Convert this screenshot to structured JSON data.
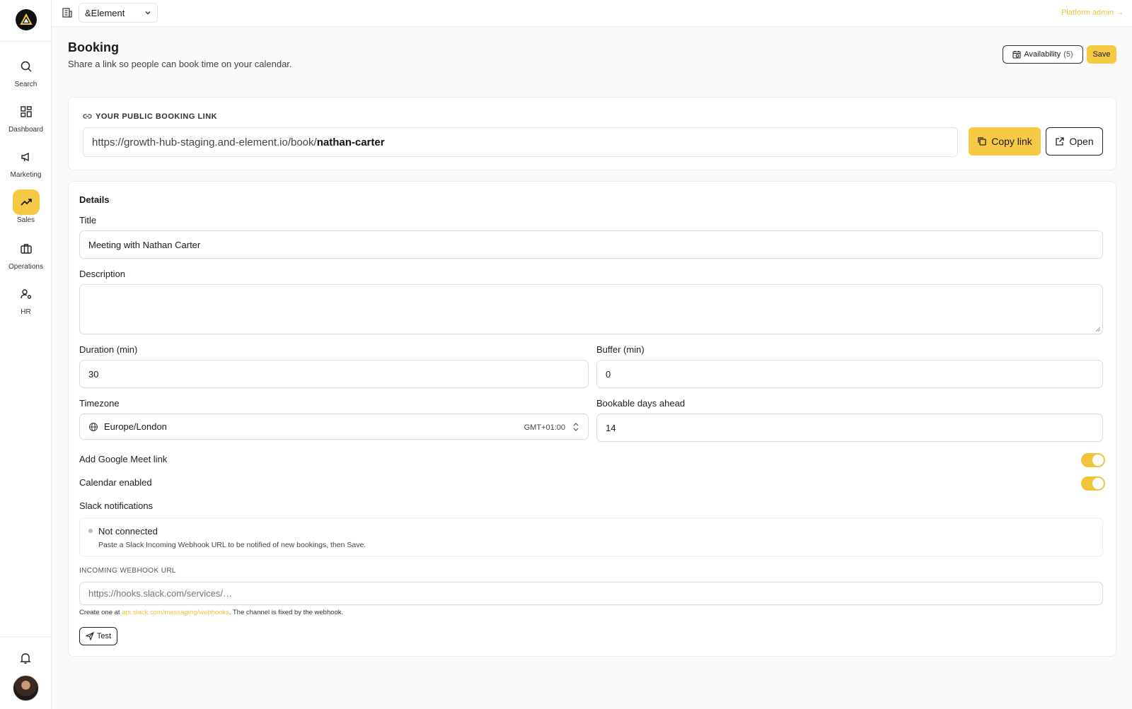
{
  "sidebar": {
    "items": [
      {
        "label": "Search",
        "icon": "search-icon"
      },
      {
        "label": "Dashboard",
        "icon": "dashboard-icon"
      },
      {
        "label": "Marketing",
        "icon": "megaphone-icon"
      },
      {
        "label": "Sales",
        "icon": "trending-up-icon",
        "active": true
      },
      {
        "label": "Operations",
        "icon": "briefcase-icon"
      },
      {
        "label": "HR",
        "icon": "user-cog-icon"
      }
    ]
  },
  "topbar": {
    "org": "&Element",
    "platform_admin": "Platform admin →"
  },
  "header": {
    "title": "Booking",
    "subtitle": "Share a link so people can book time on your calendar.",
    "availability_label": "Availability",
    "availability_count": "(5)",
    "save_label": "Save"
  },
  "link_card": {
    "heading": "YOUR PUBLIC BOOKING LINK",
    "url_prefix": "https://growth-hub-staging.and-element.io/book/",
    "url_slug": "nathan-carter",
    "copy_label": "Copy link",
    "open_label": "Open"
  },
  "details": {
    "section_title": "Details",
    "title_label": "Title",
    "title_value": "Meeting with Nathan Carter",
    "description_label": "Description",
    "description_value": "",
    "duration_label": "Duration (min)",
    "duration_value": "30",
    "buffer_label": "Buffer (min)",
    "buffer_value": "0",
    "timezone_label": "Timezone",
    "timezone_value": "Europe/London",
    "timezone_offset": "GMT+01:00",
    "days_ahead_label": "Bookable days ahead",
    "days_ahead_value": "14",
    "meet_label": "Add Google Meet link",
    "meet_enabled": true,
    "calendar_label": "Calendar enabled",
    "calendar_enabled": true,
    "slack_label": "Slack notifications",
    "slack_status": "Not connected",
    "slack_hint": "Paste a Slack Incoming Webhook URL to be notified of new bookings, then Save.",
    "webhook_label": "INCOMING WEBHOOK URL",
    "webhook_placeholder": "https://hooks.slack.com/services/…",
    "webhook_note_prefix": "Create one at ",
    "webhook_note_link": "api.slack.com/messaging/webhooks",
    "webhook_note_suffix": ". The channel is fixed by the webhook.",
    "test_label": "Test"
  },
  "colors": {
    "accent": "#f6c945",
    "accent_text": "#f0c43c"
  }
}
